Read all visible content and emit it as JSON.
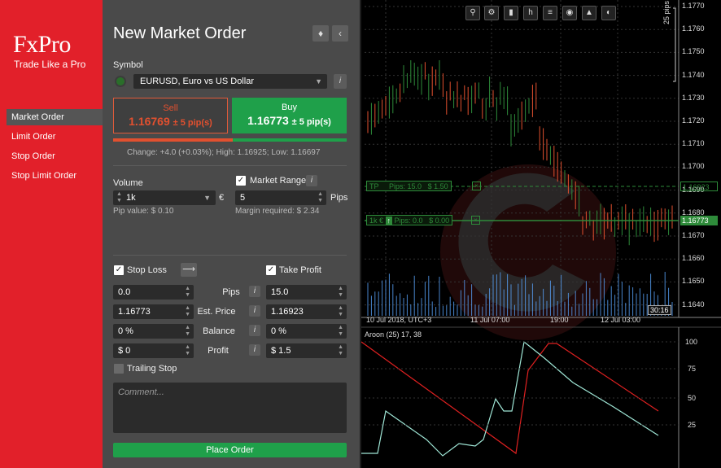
{
  "brand": {
    "name": "FxPro",
    "tagline": "Trade Like a Pro"
  },
  "sidebar": {
    "items": [
      {
        "label": "Market Order"
      },
      {
        "label": "Limit Order"
      },
      {
        "label": "Stop Order"
      },
      {
        "label": "Stop Limit Order"
      }
    ]
  },
  "order": {
    "title": "New Market Order",
    "symbol_label": "Symbol",
    "symbol_value": "EURUSD, Euro vs US Dollar",
    "sell": {
      "label": "Sell",
      "price": "1.16769",
      "spread": "± 5 pip(s)"
    },
    "buy": {
      "label": "Buy",
      "price": "1.16773",
      "spread": "± 5 pip(s)"
    },
    "stats": "Change: +4.0 (+0.03%); High: 1.16925; Low: 1.16697",
    "volume_label": "Volume",
    "volume_value": "1k",
    "currency": "€",
    "pip_value": "Pip value: $ 0.10",
    "market_range_label": "Market Range",
    "market_range_value": "5",
    "pips_unit": "Pips",
    "margin": "Margin required: $ 2.34",
    "stop_loss_label": "Stop Loss",
    "take_profit_label": "Take Profit",
    "rows": [
      {
        "label": "Pips",
        "sl": "0.0",
        "tp": "15.0"
      },
      {
        "label": "Est. Price",
        "sl": "1.16773",
        "tp": "1.16923"
      },
      {
        "label": "Balance",
        "sl": "0 %",
        "tp": "0 %"
      },
      {
        "label": "Profit",
        "sl": "$ 0",
        "tp": "$ 1.5"
      }
    ],
    "trailing_stop_label": "Trailing Stop",
    "comment_placeholder": "Comment...",
    "place_order_label": "Place Order"
  },
  "chart": {
    "price_axis": [
      "1.1770",
      "1.1760",
      "1.1750",
      "1.1740",
      "1.1730",
      "1.1720",
      "1.1710",
      "1.1700",
      "1.1690",
      "1.1680",
      "1.1670",
      "1.1660",
      "1.1650",
      "1.1640"
    ],
    "tp_price": "1.16923",
    "current_price": "1.16773",
    "pips_scale": "25 pips",
    "time_axis": [
      "10 Jul 2018, UTC+3",
      "11 Jul 07:00",
      "19:00",
      "12 Jul 03:00"
    ],
    "countdown": "30:16",
    "tp_line": {
      "tag": "TP",
      "text": "Pips: 15.0",
      "amount": "$ 1.50"
    },
    "pos_line": {
      "tag": "1k €",
      "text": "Pips: 0.0",
      "amount": "$ 0.00"
    },
    "aroon": {
      "title": "Aroon (25) 17, 38",
      "axis": [
        "100",
        "75",
        "50",
        "25"
      ]
    },
    "colors": {
      "bull": "#2e8b3a",
      "bear": "#e2502f",
      "volume": "#5aa6ff",
      "aroon_up": "#9fe6d6",
      "aroon_down": "#e02020"
    }
  }
}
